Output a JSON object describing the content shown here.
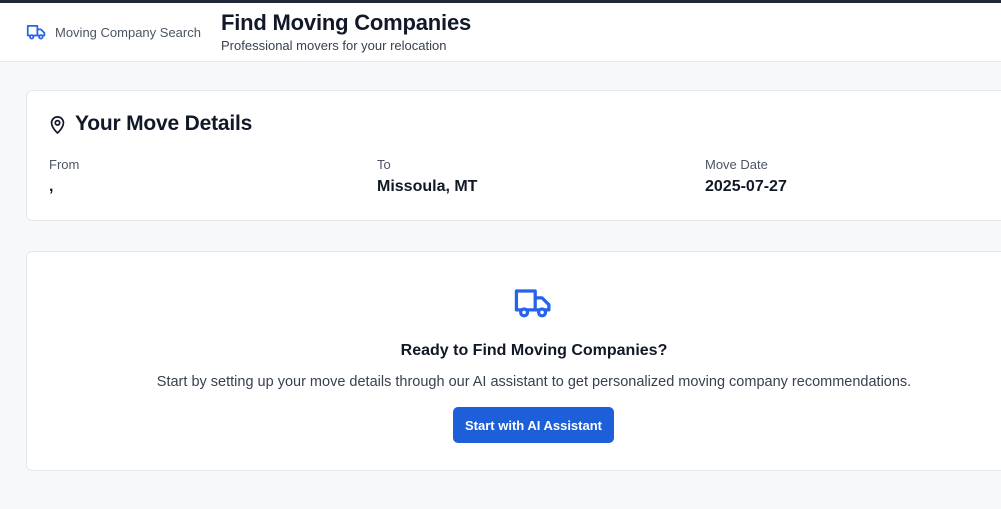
{
  "header": {
    "brand_label": "Moving Company Search",
    "brand_icon": "truck-icon",
    "title": "Find Moving Companies",
    "subtitle": "Professional movers for your relocation"
  },
  "move_details": {
    "title": "Your Move Details",
    "icon": "map-pin-icon",
    "from_label": "From",
    "from_value": ",",
    "to_label": "To",
    "to_value": "Missoula, MT",
    "date_label": "Move Date",
    "date_value": "2025-07-27"
  },
  "empty_state": {
    "icon": "truck-icon",
    "title": "Ready to Find Moving Companies?",
    "description": "Start by setting up your move details through our AI assistant to get personalized moving company recommendations.",
    "button_label": "Start with AI Assistant"
  },
  "colors": {
    "accent": "#1d5fd9",
    "icon_blue": "#2563eb",
    "background": "#f7f8fa",
    "card": "#ffffff",
    "border": "#e5e7eb"
  }
}
